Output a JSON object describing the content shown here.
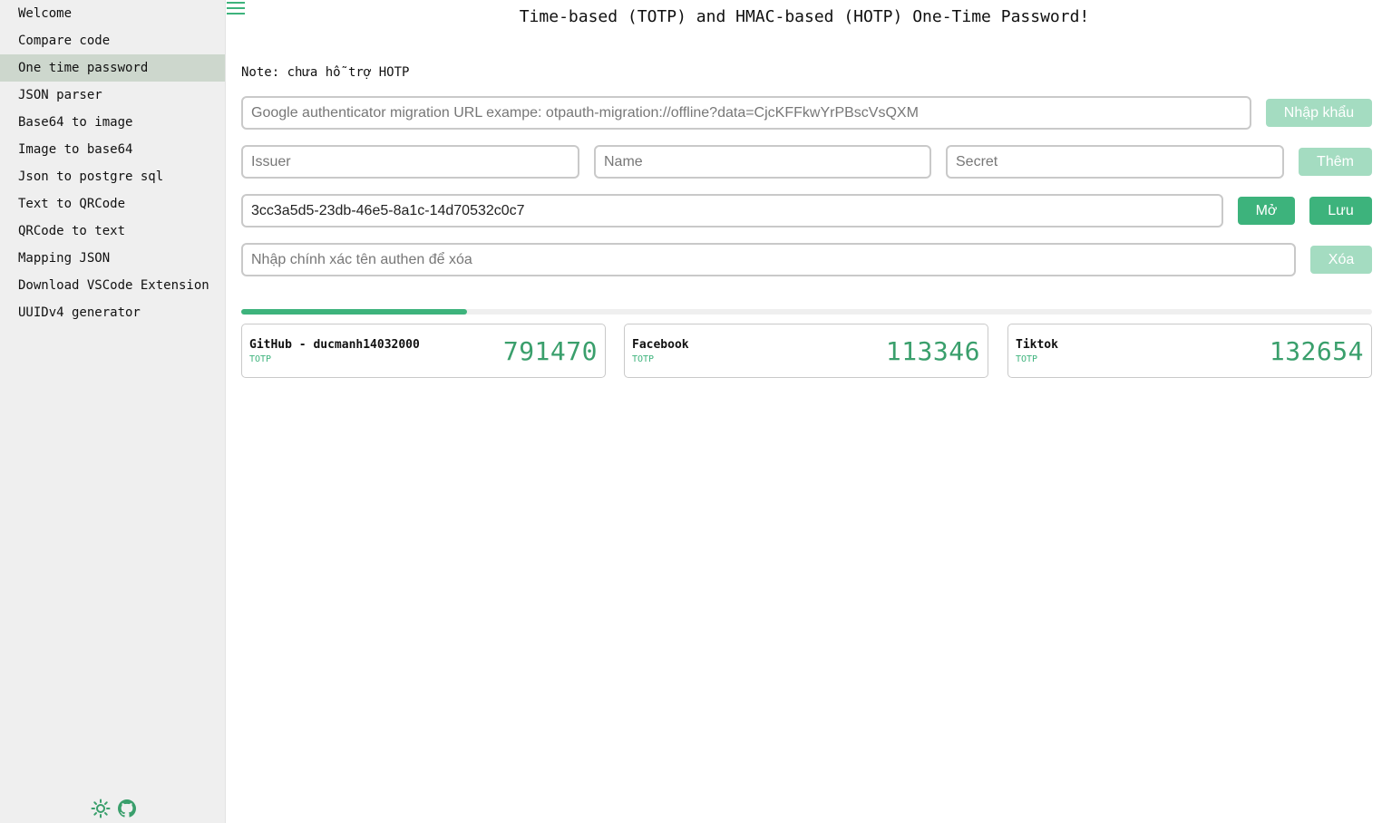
{
  "sidebar": {
    "items": [
      {
        "label": "Welcome"
      },
      {
        "label": "Compare code"
      },
      {
        "label": "One time password"
      },
      {
        "label": "JSON parser"
      },
      {
        "label": "Base64 to image"
      },
      {
        "label": "Image to base64"
      },
      {
        "label": "Json to postgre sql"
      },
      {
        "label": "Text to QRCode"
      },
      {
        "label": "QRCode to text"
      },
      {
        "label": "Mapping JSON"
      },
      {
        "label": "Download VSCode Extension"
      },
      {
        "label": "UUIDv4 generator"
      }
    ],
    "active_index": 2,
    "footer_icons": [
      "sun-icon",
      "github-icon"
    ]
  },
  "header": {
    "menu_icon": "hamburger-icon",
    "title": "Time-based (TOTP) and HMAC-based (HOTP) One-Time Password!"
  },
  "note": "Note: chưa hỗ trợ HOTP",
  "import": {
    "placeholder": "Google authenticator migration URL exampe: otpauth-migration://offline?data=CjcKFFkwYrPBscVsQXM",
    "button": "Nhập khẩu"
  },
  "add_form": {
    "issuer_placeholder": "Issuer",
    "name_placeholder": "Name",
    "secret_placeholder": "Secret",
    "button": "Thêm"
  },
  "storage": {
    "key_value": "3cc3a5d5-23db-46e5-8a1c-14d70532c0c7",
    "open_button": "Mở",
    "save_button": "Lưu"
  },
  "delete_form": {
    "placeholder": "Nhập chính xác tên authen để xóa",
    "button": "Xóa"
  },
  "timer": {
    "progress_fraction": 0.2
  },
  "accounts": [
    {
      "name": "GitHub - ducmanh14032000",
      "type": "TOTP",
      "code": "791470"
    },
    {
      "name": "Facebook",
      "type": "TOTP",
      "code": "113346"
    },
    {
      "name": "Tiktok",
      "type": "TOTP",
      "code": "132654"
    }
  ],
  "colors": {
    "accent": "#3db37c",
    "accent_disabled": "#a4dcc1",
    "sidebar_bg": "#efefef",
    "sidebar_active_bg": "#cdd7cd"
  }
}
